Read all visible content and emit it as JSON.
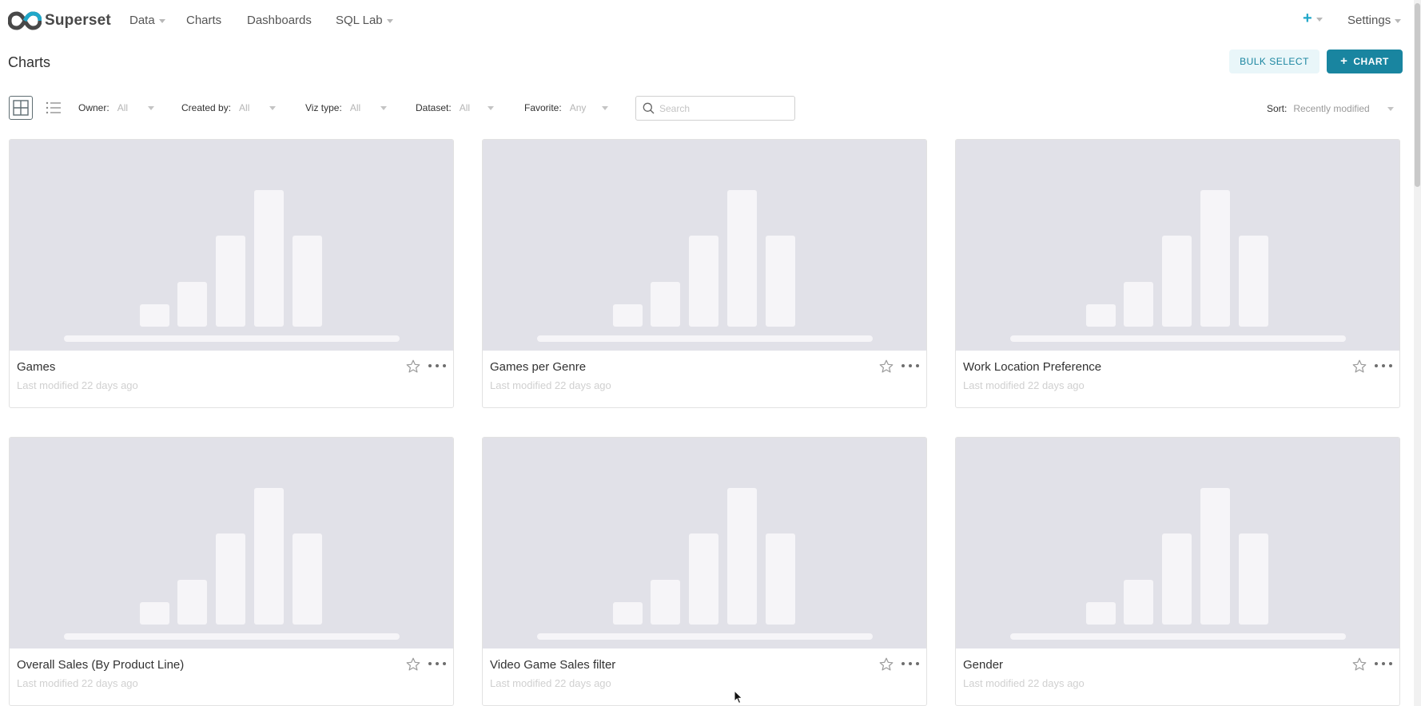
{
  "nav": {
    "brand": "Superset",
    "items": [
      {
        "label": "Data",
        "has_caret": true
      },
      {
        "label": "Charts",
        "has_caret": false
      },
      {
        "label": "Dashboards",
        "has_caret": false
      },
      {
        "label": "SQL Lab",
        "has_caret": true
      }
    ],
    "plus": "+",
    "settings": "Settings"
  },
  "page": {
    "title": "Charts",
    "bulk_select": "BULK SELECT",
    "add_chart": "CHART",
    "add_chart_icon": "+"
  },
  "filters": [
    {
      "label": "Owner:",
      "value": "All"
    },
    {
      "label": "Created by:",
      "value": "All"
    },
    {
      "label": "Viz type:",
      "value": "All"
    },
    {
      "label": "Dataset:",
      "value": "All"
    },
    {
      "label": "Favorite:",
      "value": "Any"
    }
  ],
  "search": {
    "placeholder": "Search",
    "value": ""
  },
  "sort": {
    "label": "Sort:",
    "value": "Recently modified"
  },
  "cards": [
    {
      "title": "Games",
      "modified": "Last modified 22 days ago"
    },
    {
      "title": "Games per Genre",
      "modified": "Last modified 22 days ago"
    },
    {
      "title": "Work Location Preference",
      "modified": "Last modified 22 days ago"
    },
    {
      "title": "Overall Sales (By Product Line)",
      "modified": "Last modified 22 days ago"
    },
    {
      "title": "Video Game Sales filter",
      "modified": "Last modified 22 days ago"
    },
    {
      "title": "Gender",
      "modified": "Last modified 22 days ago"
    }
  ],
  "colors": {
    "accent": "#1985a0",
    "accent_light": "#e9f6f9",
    "plus_icon": "#20a7c9",
    "thumb_bg": "#e1e1e8",
    "thumb_bars": "#f6f5f8"
  },
  "icons": {
    "logo": "superset-logo-icon",
    "card_view": "card-view-icon",
    "list_view": "list-view-icon",
    "search": "search-icon",
    "favorite": "star-icon",
    "more": "more-horizontal-icon"
  }
}
